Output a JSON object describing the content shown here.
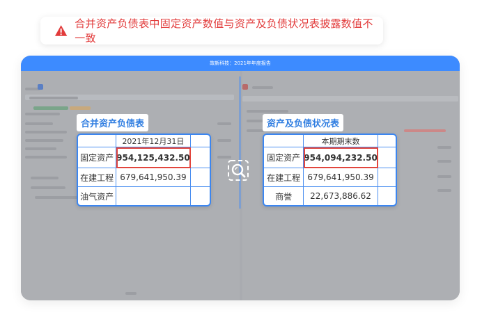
{
  "alert": {
    "text": "合并资产负债表中固定资产数值与资产及负债状况表披露数值不一致",
    "icon": "warning-icon",
    "color": "#e23b3b"
  },
  "window": {
    "title": "故新科技：2021年年度报告",
    "accent": "#3d8bff"
  },
  "left_table": {
    "label": "合并资产负债表",
    "header": "2021年12月31日",
    "rows": [
      {
        "name": "固定资产",
        "value": "954,125,432.50"
      },
      {
        "name": "在建工程",
        "value": "679,641,950.39"
      },
      {
        "name": "油气资产",
        "value": ""
      }
    ]
  },
  "right_table": {
    "label": "资产及负债状况表",
    "header": "本期期末数",
    "rows": [
      {
        "name": "固定资产",
        "value": "954,094,232.50"
      },
      {
        "name": "在建工程",
        "value": "679,641,950.39"
      },
      {
        "name": "商誉",
        "value": "22,673,886.62"
      }
    ]
  },
  "compare": {
    "icon": "compare-magnifier-icon"
  }
}
